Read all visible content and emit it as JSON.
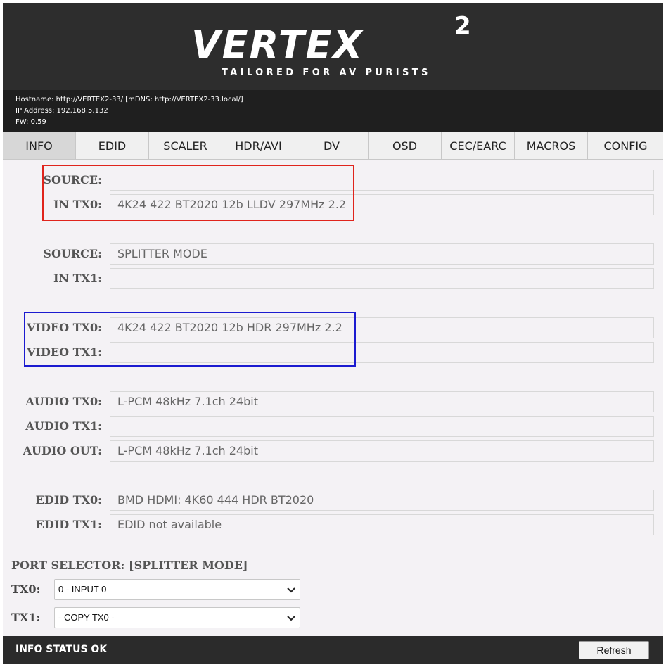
{
  "header": {
    "logo": "VERTEX",
    "logo_superscript": "2",
    "tagline": "TAILORED FOR AV PURISTS",
    "hostname": "Hostname: http://VERTEX2-33/ [mDNS: http://VERTEX2-33.local/]",
    "ip": "IP Address: 192.168.5.132",
    "fw": "FW: 0.59"
  },
  "tabs": [
    {
      "label": "INFO",
      "active": true
    },
    {
      "label": "EDID"
    },
    {
      "label": "SCALER"
    },
    {
      "label": "HDR/AVI"
    },
    {
      "label": "DV"
    },
    {
      "label": "OSD"
    },
    {
      "label": "CEC/EARC"
    },
    {
      "label": "MACROS"
    },
    {
      "label": "CONFIG"
    }
  ],
  "info": {
    "source0": {
      "label": "SOURCE:",
      "value": ""
    },
    "in_tx0": {
      "label": "IN TX0:",
      "value": "4K24 422 BT2020 12b LLDV 297MHz 2.2"
    },
    "source1": {
      "label": "SOURCE:",
      "value": "SPLITTER MODE"
    },
    "in_tx1": {
      "label": "IN TX1:",
      "value": ""
    },
    "video_tx0": {
      "label": "VIDEO TX0:",
      "value": "4K24 422 BT2020 12b HDR 297MHz 2.2"
    },
    "video_tx1": {
      "label": "VIDEO TX1:",
      "value": ""
    },
    "audio_tx0": {
      "label": "AUDIO TX0:",
      "value": "L-PCM 48kHz 7.1ch 24bit"
    },
    "audio_tx1": {
      "label": "AUDIO TX1:",
      "value": ""
    },
    "audio_out": {
      "label": "AUDIO OUT:",
      "value": "L-PCM 48kHz 7.1ch 24bit"
    },
    "edid_tx0": {
      "label": "EDID TX0:",
      "value": "BMD HDMI: 4K60 444 HDR BT2020"
    },
    "edid_tx1": {
      "label": "EDID TX1:",
      "value": "EDID not available"
    }
  },
  "port_selector": {
    "title": "PORT SELECTOR: [SPLITTER MODE]",
    "tx0_label": "TX0:",
    "tx0_value": "0 - INPUT 0",
    "tx1_label": "TX1:",
    "tx1_value": "- COPY TX0 -"
  },
  "status": {
    "text": "INFO STATUS OK",
    "refresh_label": "Refresh"
  },
  "colors": {
    "highlight_red": "#e0241c",
    "highlight_blue": "#1b1bd0",
    "header_bg": "#2d2d2d"
  }
}
